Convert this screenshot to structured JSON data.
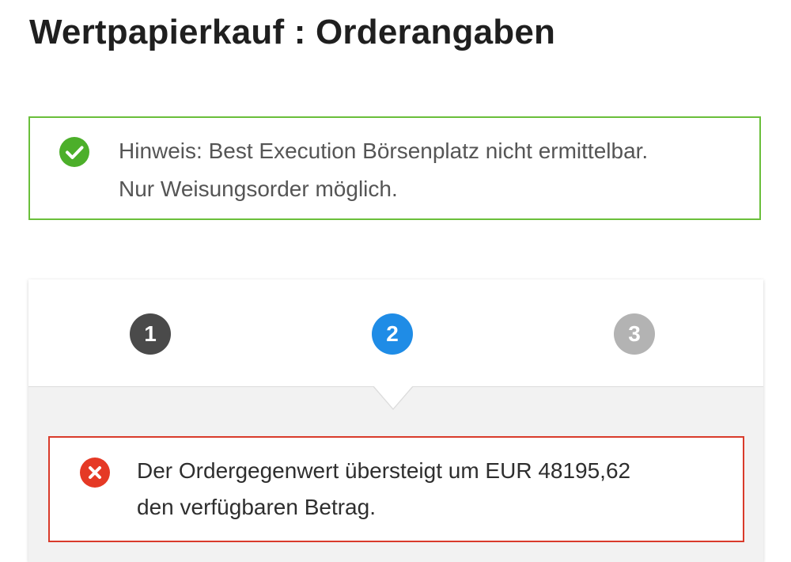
{
  "page": {
    "title": "Wertpapierkauf : Orderangaben"
  },
  "notice": {
    "icon": "check-circle-icon",
    "color": "#6abf3b",
    "line1": "Hinweis: Best Execution Börsenplatz nicht ermittelbar.",
    "line2": "Nur Weisungsorder möglich."
  },
  "stepper": {
    "steps": [
      {
        "label": "1",
        "state": "completed",
        "color": "#4a4a4a"
      },
      {
        "label": "2",
        "state": "active",
        "color": "#1f8ce6"
      },
      {
        "label": "3",
        "state": "upcoming",
        "color": "#b3b3b3"
      }
    ]
  },
  "error": {
    "icon": "error-x-circle-icon",
    "color": "#d93b2b",
    "line1": "Der Ordergegenwert übersteigt um EUR 48195,62",
    "line2": "den verfügbaren Betrag."
  }
}
